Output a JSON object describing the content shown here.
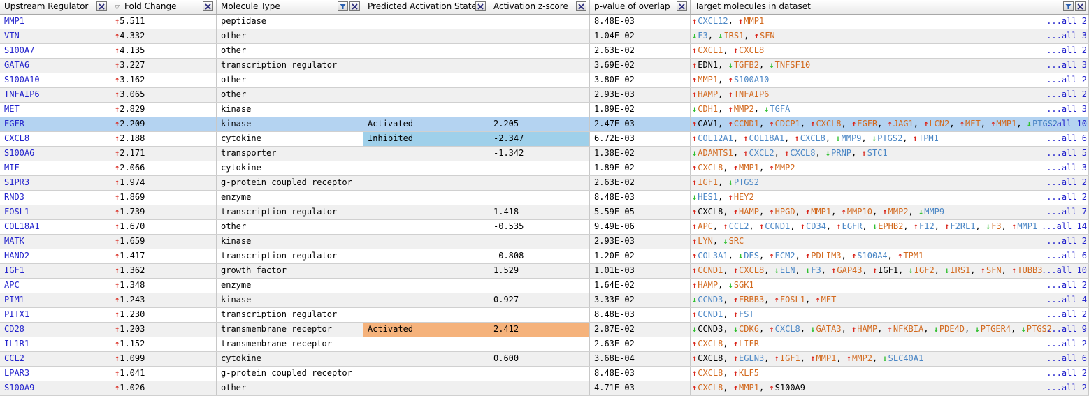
{
  "columns": [
    {
      "label": "Upstream Regulator",
      "filter": false,
      "sorted": false
    },
    {
      "label": "Fold Change",
      "filter": false,
      "sorted": true
    },
    {
      "label": "Molecule Type",
      "filter": true,
      "sorted": false
    },
    {
      "label": "Predicted Activation State",
      "filter": false,
      "sorted": false
    },
    {
      "label": "Activation z-score",
      "filter": false,
      "sorted": false
    },
    {
      "label": "p-value of overlap",
      "filter": false,
      "sorted": false
    },
    {
      "label": "Target molecules in dataset",
      "filter": true,
      "sorted": false
    }
  ],
  "colors": {
    "activated": "#f5b27b",
    "inhibited": "#9fd0ea",
    "selected_row": "#b4d3f1",
    "up_arrow": "#d9261c",
    "down_arrow": "#2fbf2f",
    "target_up": "#d2691e",
    "target_down": "#4a86c5"
  },
  "rows": [
    {
      "gene": "MMP1",
      "fc": "5.511",
      "type": "peptidase",
      "state": "",
      "z": "",
      "p": "8.48E-03",
      "targets": [
        [
          "u",
          "CXCL12",
          "d"
        ],
        [
          "u",
          "MMP1",
          "u"
        ]
      ],
      "more": "...all 2"
    },
    {
      "gene": "VTN",
      "fc": "4.332",
      "type": "other",
      "state": "",
      "z": "",
      "p": "1.04E-02",
      "targets": [
        [
          "d",
          "F3",
          "d"
        ],
        [
          "d",
          "IRS1",
          "u"
        ],
        [
          "u",
          "SFN",
          "u"
        ]
      ],
      "more": "...all 3"
    },
    {
      "gene": "S100A7",
      "fc": "4.135",
      "type": "other",
      "state": "",
      "z": "",
      "p": "2.63E-02",
      "targets": [
        [
          "u",
          "CXCL1",
          "u"
        ],
        [
          "u",
          "CXCL8",
          "u"
        ]
      ],
      "more": "...all 2"
    },
    {
      "gene": "GATA6",
      "fc": "3.227",
      "type": "transcription regulator",
      "state": "",
      "z": "",
      "p": "3.69E-02",
      "targets": [
        [
          "u",
          "EDN1",
          "n"
        ],
        [
          "d",
          "TGFB2",
          "u"
        ],
        [
          "d",
          "TNFSF10",
          "u"
        ]
      ],
      "more": "...all 3"
    },
    {
      "gene": "S100A10",
      "fc": "3.162",
      "type": "other",
      "state": "",
      "z": "",
      "p": "3.80E-02",
      "targets": [
        [
          "u",
          "MMP1",
          "u"
        ],
        [
          "u",
          "S100A10",
          "d"
        ]
      ],
      "more": "...all 2"
    },
    {
      "gene": "TNFAIP6",
      "fc": "3.065",
      "type": "other",
      "state": "",
      "z": "",
      "p": "2.93E-03",
      "targets": [
        [
          "u",
          "HAMP",
          "u"
        ],
        [
          "u",
          "TNFAIP6",
          "u"
        ]
      ],
      "more": "...all 2"
    },
    {
      "gene": "MET",
      "fc": "2.829",
      "type": "kinase",
      "state": "",
      "z": "",
      "p": "1.89E-02",
      "targets": [
        [
          "d",
          "CDH1",
          "u"
        ],
        [
          "u",
          "MMP2",
          "u"
        ],
        [
          "d",
          "TGFA",
          "d"
        ]
      ],
      "more": "...all 3"
    },
    {
      "gene": "EGFR",
      "fc": "2.209",
      "type": "kinase",
      "state": "Activated",
      "stateClass": "sel",
      "z": "2.205",
      "p": "2.47E-03",
      "targets": [
        [
          "u",
          "CAV1",
          "n"
        ],
        [
          "u",
          "CCND1",
          "u"
        ],
        [
          "u",
          "CDCP1",
          "u"
        ],
        [
          "u",
          "CXCL8",
          "u"
        ],
        [
          "u",
          "EGFR",
          "u"
        ],
        [
          "u",
          "JAG1",
          "u"
        ],
        [
          "u",
          "LCN2",
          "u"
        ],
        [
          "u",
          "MET",
          "u"
        ],
        [
          "u",
          "MMP1",
          "u"
        ],
        [
          "d",
          "PTGS2",
          "d"
        ]
      ],
      "more": "...all 10"
    },
    {
      "gene": "CXCL8",
      "fc": "2.188",
      "type": "cytokine",
      "state": "Inhibited",
      "stateClass": "inhibited",
      "z": "-2.347",
      "p": "6.72E-03",
      "targets": [
        [
          "u",
          "COL12A1",
          "d"
        ],
        [
          "u",
          "COL18A1",
          "d"
        ],
        [
          "u",
          "CXCL8",
          "d"
        ],
        [
          "d",
          "MMP9",
          "d"
        ],
        [
          "d",
          "PTGS2",
          "d"
        ],
        [
          "u",
          "TPM1",
          "d"
        ]
      ],
      "more": "...all 6"
    },
    {
      "gene": "S100A6",
      "fc": "2.171",
      "type": "transporter",
      "state": "",
      "z": "-1.342",
      "p": "1.38E-02",
      "targets": [
        [
          "d",
          "ADAMTS1",
          "u"
        ],
        [
          "u",
          "CXCL2",
          "d"
        ],
        [
          "u",
          "CXCL8",
          "d"
        ],
        [
          "d",
          "PRNP",
          "d"
        ],
        [
          "u",
          "STC1",
          "d"
        ]
      ],
      "more": "...all 5"
    },
    {
      "gene": "MIF",
      "fc": "2.066",
      "type": "cytokine",
      "state": "",
      "z": "",
      "p": "1.89E-02",
      "targets": [
        [
          "u",
          "CXCL8",
          "u"
        ],
        [
          "u",
          "MMP1",
          "u"
        ],
        [
          "u",
          "MMP2",
          "u"
        ]
      ],
      "more": "...all 3"
    },
    {
      "gene": "S1PR3",
      "fc": "1.974",
      "type": "g-protein coupled receptor",
      "state": "",
      "z": "",
      "p": "2.63E-02",
      "targets": [
        [
          "u",
          "IGF1",
          "u"
        ],
        [
          "d",
          "PTGS2",
          "d"
        ]
      ],
      "more": "...all 2"
    },
    {
      "gene": "RND3",
      "fc": "1.869",
      "type": "enzyme",
      "state": "",
      "z": "",
      "p": "8.48E-03",
      "targets": [
        [
          "d",
          "HES1",
          "d"
        ],
        [
          "u",
          "HEY2",
          "u"
        ]
      ],
      "more": "...all 2"
    },
    {
      "gene": "FOSL1",
      "fc": "1.739",
      "type": "transcription regulator",
      "state": "",
      "z": "1.418",
      "p": "5.59E-05",
      "targets": [
        [
          "u",
          "CXCL8",
          "n"
        ],
        [
          "u",
          "HAMP",
          "u"
        ],
        [
          "u",
          "HPGD",
          "u"
        ],
        [
          "u",
          "MMP1",
          "u"
        ],
        [
          "u",
          "MMP10",
          "u"
        ],
        [
          "u",
          "MMP2",
          "u"
        ],
        [
          "d",
          "MMP9",
          "d"
        ]
      ],
      "more": "...all 7"
    },
    {
      "gene": "COL18A1",
      "fc": "1.670",
      "type": "other",
      "state": "",
      "z": "-0.535",
      "p": "9.49E-06",
      "targets": [
        [
          "u",
          "APC",
          "u"
        ],
        [
          "u",
          "CCL2",
          "d"
        ],
        [
          "u",
          "CCND1",
          "d"
        ],
        [
          "u",
          "CD34",
          "d"
        ],
        [
          "u",
          "EGFR",
          "d"
        ],
        [
          "d",
          "EPHB2",
          "u"
        ],
        [
          "u",
          "F12",
          "d"
        ],
        [
          "u",
          "F2RL1",
          "d"
        ],
        [
          "d",
          "F3",
          "u"
        ],
        [
          "u",
          "MMP1",
          "d"
        ]
      ],
      "more": "...all 14"
    },
    {
      "gene": "MATK",
      "fc": "1.659",
      "type": "kinase",
      "state": "",
      "z": "",
      "p": "2.93E-03",
      "targets": [
        [
          "u",
          "LYN",
          "u"
        ],
        [
          "d",
          "SRC",
          "u"
        ]
      ],
      "more": "...all 2"
    },
    {
      "gene": "HAND2",
      "fc": "1.417",
      "type": "transcription regulator",
      "state": "",
      "z": "-0.808",
      "p": "1.20E-02",
      "targets": [
        [
          "u",
          "COL3A1",
          "d"
        ],
        [
          "d",
          "DES",
          "d"
        ],
        [
          "u",
          "ECM2",
          "d"
        ],
        [
          "u",
          "PDLIM3",
          "u"
        ],
        [
          "u",
          "S100A4",
          "d"
        ],
        [
          "u",
          "TPM1",
          "u"
        ]
      ],
      "more": "...all 6"
    },
    {
      "gene": "IGF1",
      "fc": "1.362",
      "type": "growth factor",
      "state": "",
      "z": "1.529",
      "p": "1.01E-03",
      "targets": [
        [
          "u",
          "CCND1",
          "u"
        ],
        [
          "u",
          "CXCL8",
          "u"
        ],
        [
          "d",
          "ELN",
          "d"
        ],
        [
          "d",
          "F3",
          "d"
        ],
        [
          "u",
          "GAP43",
          "u"
        ],
        [
          "u",
          "IGF1",
          "n"
        ],
        [
          "d",
          "IGF2",
          "u"
        ],
        [
          "d",
          "IRS1",
          "u"
        ],
        [
          "u",
          "SFN",
          "u"
        ],
        [
          "u",
          "TUBB3",
          "u"
        ]
      ],
      "more": "...all 10"
    },
    {
      "gene": "APC",
      "fc": "1.348",
      "type": "enzyme",
      "state": "",
      "z": "",
      "p": "1.64E-02",
      "targets": [
        [
          "u",
          "HAMP",
          "u"
        ],
        [
          "d",
          "SGK1",
          "u"
        ]
      ],
      "more": "...all 2"
    },
    {
      "gene": "PIM1",
      "fc": "1.243",
      "type": "kinase",
      "state": "",
      "z": "0.927",
      "p": "3.33E-02",
      "targets": [
        [
          "d",
          "CCND3",
          "d"
        ],
        [
          "u",
          "ERBB3",
          "u"
        ],
        [
          "u",
          "FOSL1",
          "u"
        ],
        [
          "u",
          "MET",
          "u"
        ]
      ],
      "more": "...all 4"
    },
    {
      "gene": "PITX1",
      "fc": "1.230",
      "type": "transcription regulator",
      "state": "",
      "z": "",
      "p": "8.48E-03",
      "targets": [
        [
          "u",
          "CCND1",
          "d"
        ],
        [
          "u",
          "FST",
          "d"
        ]
      ],
      "more": "...all 2"
    },
    {
      "gene": "CD28",
      "fc": "1.203",
      "type": "transmembrane receptor",
      "state": "Activated",
      "stateClass": "activated",
      "z": "2.412",
      "p": "2.87E-02",
      "targets": [
        [
          "d",
          "CCND3",
          "n"
        ],
        [
          "d",
          "CDK6",
          "u"
        ],
        [
          "u",
          "CXCL8",
          "d"
        ],
        [
          "d",
          "GATA3",
          "u"
        ],
        [
          "u",
          "HAMP",
          "u"
        ],
        [
          "u",
          "NFKBIA",
          "u"
        ],
        [
          "d",
          "PDE4D",
          "u"
        ],
        [
          "d",
          "PTGER4",
          "u"
        ],
        [
          "d",
          "PTGS2",
          "u"
        ]
      ],
      "more": "...all 9"
    },
    {
      "gene": "IL1R1",
      "fc": "1.152",
      "type": "transmembrane receptor",
      "state": "",
      "z": "",
      "p": "2.63E-02",
      "targets": [
        [
          "u",
          "CXCL8",
          "u"
        ],
        [
          "u",
          "LIFR",
          "u"
        ]
      ],
      "more": "...all 2"
    },
    {
      "gene": "CCL2",
      "fc": "1.099",
      "type": "cytokine",
      "state": "",
      "z": "0.600",
      "p": "3.68E-04",
      "targets": [
        [
          "u",
          "CXCL8",
          "n"
        ],
        [
          "u",
          "EGLN3",
          "d"
        ],
        [
          "u",
          "IGF1",
          "u"
        ],
        [
          "u",
          "MMP1",
          "u"
        ],
        [
          "u",
          "MMP2",
          "u"
        ],
        [
          "d",
          "SLC40A1",
          "d"
        ]
      ],
      "more": "...all 6"
    },
    {
      "gene": "LPAR3",
      "fc": "1.041",
      "type": "g-protein coupled receptor",
      "state": "",
      "z": "",
      "p": "8.48E-03",
      "targets": [
        [
          "u",
          "CXCL8",
          "u"
        ],
        [
          "u",
          "KLF5",
          "u"
        ]
      ],
      "more": "...all 2"
    },
    {
      "gene": "S100A9",
      "fc": "1.026",
      "type": "other",
      "state": "",
      "z": "",
      "p": "4.71E-03",
      "targets": [
        [
          "u",
          "CXCL8",
          "u"
        ],
        [
          "u",
          "MMP1",
          "u"
        ],
        [
          "u",
          "S100A9",
          "n"
        ]
      ],
      "more": "...all 2"
    }
  ]
}
